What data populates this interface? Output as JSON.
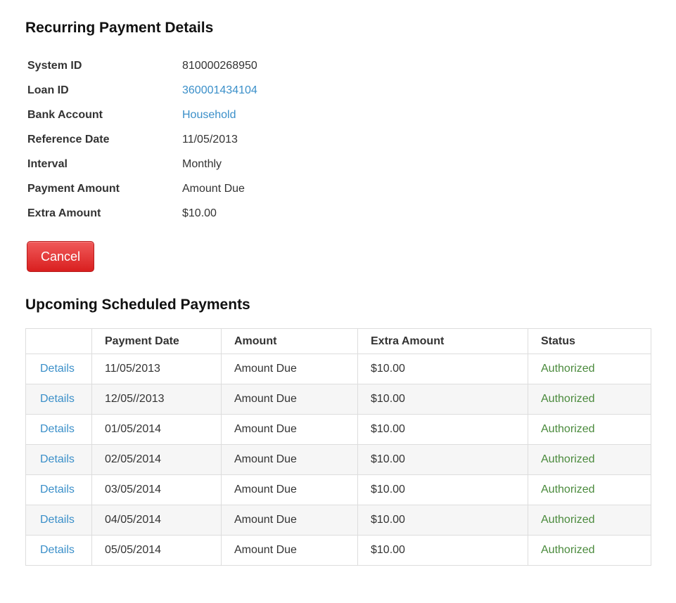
{
  "recurring": {
    "title": "Recurring Payment Details",
    "fields": [
      {
        "label": "System ID",
        "value": "810000268950",
        "link": false
      },
      {
        "label": "Loan ID",
        "value": "360001434104",
        "link": true
      },
      {
        "label": "Bank Account",
        "value": "Household",
        "link": true
      },
      {
        "label": "Reference Date",
        "value": "11/05/2013",
        "link": false
      },
      {
        "label": "Interval",
        "value": "Monthly",
        "link": false
      },
      {
        "label": "Payment Amount",
        "value": "Amount Due",
        "link": false
      },
      {
        "label": "Extra Amount",
        "value": "$10.00",
        "link": false
      }
    ],
    "cancel_label": "Cancel"
  },
  "upcoming": {
    "title": "Upcoming Scheduled Payments",
    "columns": [
      "",
      "Payment Date",
      "Amount",
      "Extra Amount",
      "Status"
    ],
    "rows": [
      {
        "link": "Details",
        "date": "11/05/2013",
        "amount": "Amount Due",
        "extra": "$10.00",
        "status": "Authorized"
      },
      {
        "link": "Details",
        "date": "12/05//2013",
        "amount": "Amount Due",
        "extra": "$10.00",
        "status": "Authorized"
      },
      {
        "link": "Details",
        "date": "01/05/2014",
        "amount": "Amount Due",
        "extra": "$10.00",
        "status": "Authorized"
      },
      {
        "link": "Details",
        "date": "02/05/2014",
        "amount": "Amount Due",
        "extra": "$10.00",
        "status": "Authorized"
      },
      {
        "link": "Details",
        "date": "03/05/2014",
        "amount": "Amount Due",
        "extra": "$10.00",
        "status": "Authorized"
      },
      {
        "link": "Details",
        "date": "04/05/2014",
        "amount": "Amount Due",
        "extra": "$10.00",
        "status": "Authorized"
      },
      {
        "link": "Details",
        "date": "05/05/2014",
        "amount": "Amount Due",
        "extra": "$10.00",
        "status": "Authorized"
      }
    ]
  },
  "colors": {
    "link": "#3a8fc9",
    "status_authorized": "#4a8a3c",
    "cancel_button": "#d91f1f"
  }
}
